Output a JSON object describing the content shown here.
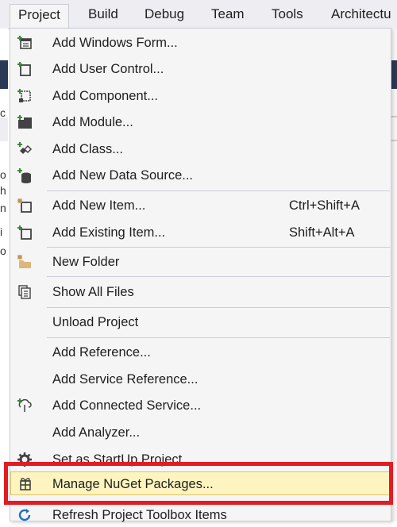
{
  "menubar": {
    "items": [
      {
        "label": "Project"
      },
      {
        "label": "Build"
      },
      {
        "label": "Debug"
      },
      {
        "label": "Team"
      },
      {
        "label": "Tools"
      },
      {
        "label": "Architectu"
      }
    ]
  },
  "background": {
    "fragments": [
      "c",
      "o",
      "h",
      "n",
      "i",
      "o"
    ]
  },
  "dropdown": {
    "items": [
      {
        "label": "Add Windows Form...",
        "icon": "windows-form-icon"
      },
      {
        "label": "Add User Control...",
        "icon": "user-control-icon"
      },
      {
        "label": "Add Component...",
        "icon": "component-icon"
      },
      {
        "label": "Add Module...",
        "icon": "module-icon"
      },
      {
        "label": "Add Class...",
        "icon": "class-icon"
      },
      {
        "label": "Add New Data Source...",
        "icon": "data-source-icon"
      },
      {
        "label": "Add New Item...",
        "shortcut": "Ctrl+Shift+A",
        "icon": "new-item-icon"
      },
      {
        "label": "Add Existing Item...",
        "shortcut": "Shift+Alt+A",
        "icon": "existing-item-icon"
      },
      {
        "label": "New Folder",
        "icon": "new-folder-icon"
      },
      {
        "label": "Show All Files",
        "icon": "show-all-files-icon"
      },
      {
        "label": "Unload Project"
      },
      {
        "label": "Add Reference..."
      },
      {
        "label": "Add Service Reference..."
      },
      {
        "label": "Add Connected Service...",
        "icon": "connected-service-icon"
      },
      {
        "label": "Add Analyzer..."
      },
      {
        "label": "Set as StartUp Project",
        "icon": "gear-icon"
      },
      {
        "label": "Manage NuGet Packages...",
        "icon": "nuget-package-icon"
      },
      {
        "label": "Refresh Project Toolbox Items",
        "icon": "refresh-icon"
      }
    ]
  },
  "colors": {
    "highlight": "#fdf4bf",
    "annotation_box": "#e31b23",
    "menubar": "#eeeef2"
  }
}
